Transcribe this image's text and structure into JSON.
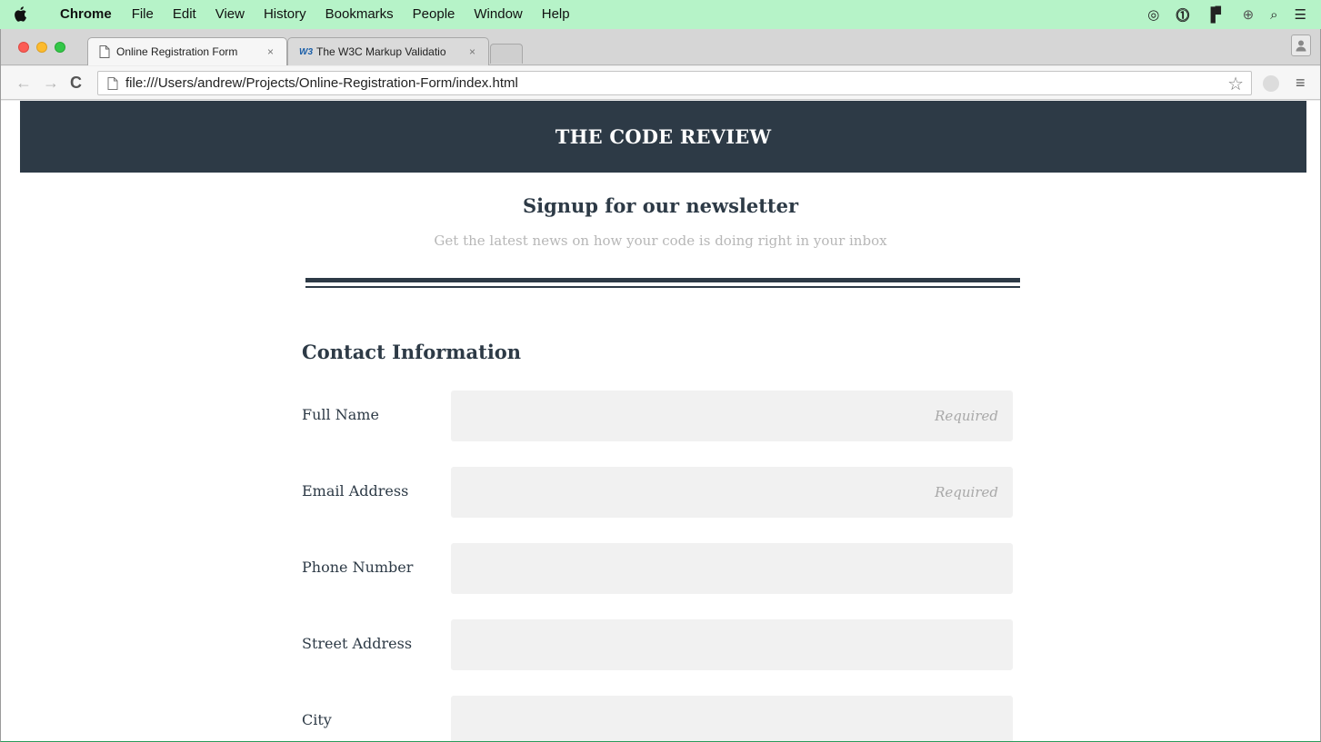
{
  "menubar": {
    "app": "Chrome",
    "items": [
      "File",
      "Edit",
      "View",
      "History",
      "Bookmarks",
      "People",
      "Window",
      "Help"
    ]
  },
  "tabs": [
    {
      "title": "Online Registration Form",
      "active": true
    },
    {
      "title": "The W3C Markup Validatio",
      "active": false,
      "icon_text": "W3"
    }
  ],
  "toolbar": {
    "url": "file:///Users/andrew/Projects/Online-Registration-Form/index.html"
  },
  "page": {
    "site_title": "THE CODE REVIEW",
    "hero_title": "Signup for our newsletter",
    "hero_subtitle": "Get the latest news on how your code is doing right in your inbox",
    "section_title": "Contact Information",
    "fields": [
      {
        "label": "Full Name",
        "placeholder": "Required"
      },
      {
        "label": "Email Address",
        "placeholder": "Required"
      },
      {
        "label": "Phone Number",
        "placeholder": ""
      },
      {
        "label": "Street Address",
        "placeholder": ""
      },
      {
        "label": "City",
        "placeholder": ""
      }
    ]
  },
  "colors": {
    "header_bg": "#2d3a46",
    "input_bg": "#f1f1f1",
    "menubar_bg": "#b6f3c8"
  }
}
